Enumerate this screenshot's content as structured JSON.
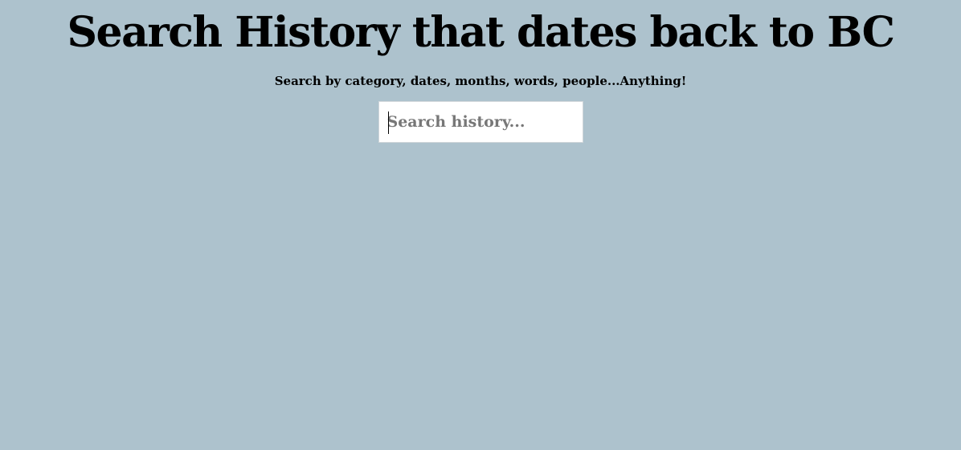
{
  "page": {
    "title": "Search History that dates back to BC",
    "subtitle": "Search by category, dates, months, words, people...Anything!"
  },
  "search": {
    "placeholder": "Search history...",
    "value": ""
  },
  "colors": {
    "background": "#adc2cd",
    "input_background": "#ffffff",
    "placeholder": "#777777",
    "text": "#000000"
  }
}
